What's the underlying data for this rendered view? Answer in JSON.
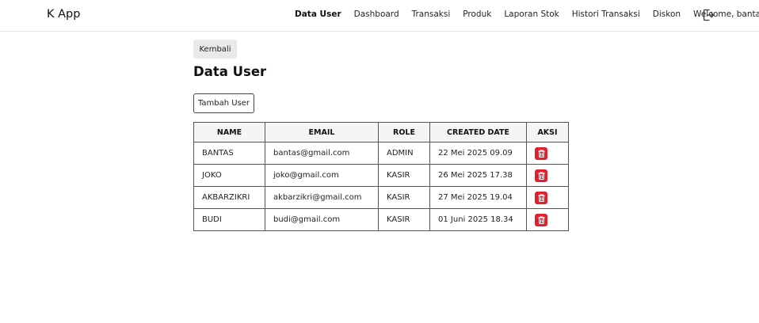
{
  "app": {
    "brand": "K App"
  },
  "nav": {
    "items": [
      {
        "label": "Data User",
        "active": true
      },
      {
        "label": "Dashboard"
      },
      {
        "label": "Transaksi"
      },
      {
        "label": "Produk"
      },
      {
        "label": "Laporan Stok"
      },
      {
        "label": "Histori Transaksi"
      },
      {
        "label": "Diskon"
      }
    ],
    "welcome": "Welcome, bantas",
    "logout_icon": "logout-icon"
  },
  "page": {
    "back_label": "Kembali",
    "title": "Data User",
    "add_label": "Tambah User"
  },
  "table": {
    "headers": [
      "NAME",
      "EMAIL",
      "ROLE",
      "CREATED DATE",
      "AKSI"
    ],
    "rows": [
      {
        "name": "BANTAS",
        "email": "bantas@gmail.com",
        "role": "ADMIN",
        "created": "22 Mei 2025 09.09"
      },
      {
        "name": "JOKO",
        "email": "joko@gmail.com",
        "role": "KASIR",
        "created": "26 Mei 2025 17.38"
      },
      {
        "name": "AKBARZIKRI",
        "email": "akbarzikri@gmail.com",
        "role": "KASIR",
        "created": "27 Mei 2025 19.04"
      },
      {
        "name": "BUDI",
        "email": "budi@gmail.com",
        "role": "KASIR",
        "created": "01 Juni 2025 18.34"
      }
    ],
    "delete_icon": "trash-icon"
  },
  "colors": {
    "delete": "#e0202c",
    "header_bg": "#f5f5f6",
    "back_bg": "#e9e9ea"
  }
}
